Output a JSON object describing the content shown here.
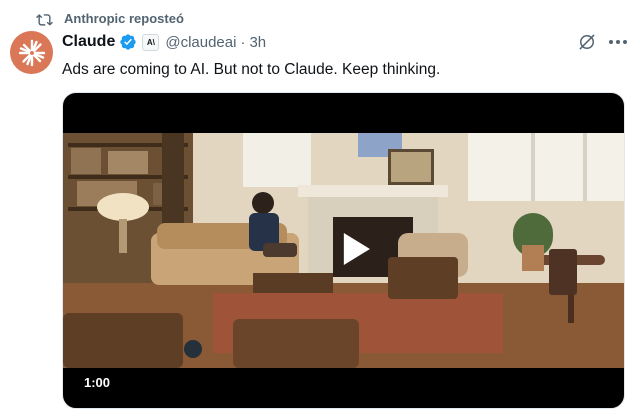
{
  "repost": {
    "label": "Anthropic reposteó",
    "icon": "repost-icon"
  },
  "tweet": {
    "author_name": "Claude",
    "handle": "@claudeai",
    "separator": "·",
    "time": "3h",
    "affiliate_badge": "A\\",
    "text": "Ads are coming to AI. But not to Claude. Keep thinking.",
    "verified_color": "#1d9bf0",
    "avatar_color": "#d97757"
  },
  "video": {
    "duration": "1:00",
    "icon": "play-icon"
  }
}
